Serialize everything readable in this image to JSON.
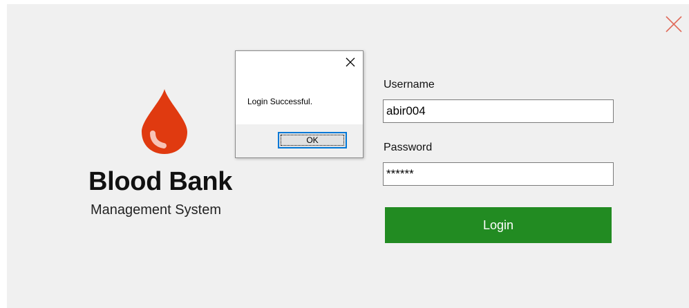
{
  "app": {
    "brand_title": "Blood Bank",
    "brand_subtitle": "Management System",
    "drop_color": "#e03a10",
    "accent_green": "#228b22",
    "close_color": "#e06a5a"
  },
  "form": {
    "username_label": "Username",
    "username_value": "abir004",
    "password_label": "Password",
    "password_value": "******",
    "login_label": "Login"
  },
  "dialog": {
    "message": "Login Successful.",
    "ok_label": "OK"
  },
  "icons": {
    "window_close": "close-icon",
    "dialog_close": "close-icon",
    "logo": "blood-drop-icon"
  }
}
